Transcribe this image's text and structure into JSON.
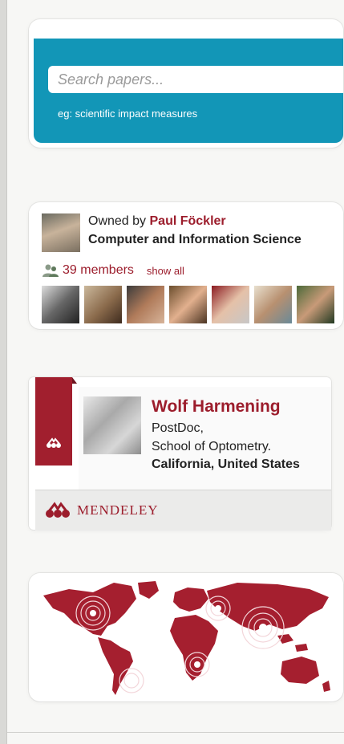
{
  "search": {
    "placeholder": "Search papers...",
    "example": "eg: scientific impact measures"
  },
  "group": {
    "owned_by_label": "Owned by",
    "owner_name": "Paul Föckler",
    "group_name": "Computer and Information Science",
    "members_count": "39 members",
    "show_all": "show all",
    "member_avatars": 7
  },
  "profile": {
    "name": "Wolf Harmening",
    "role": "PostDoc,",
    "institution": "School of Optometry.",
    "location": "California, United States"
  },
  "brand": {
    "name": "MENDELEY",
    "color": "#9c1d2c"
  },
  "colors": {
    "search_panel": "#1296b7",
    "accent_red": "#9c1d2c"
  },
  "icons": [
    "members-icon",
    "mendeley-logo-icon",
    "world-map"
  ]
}
